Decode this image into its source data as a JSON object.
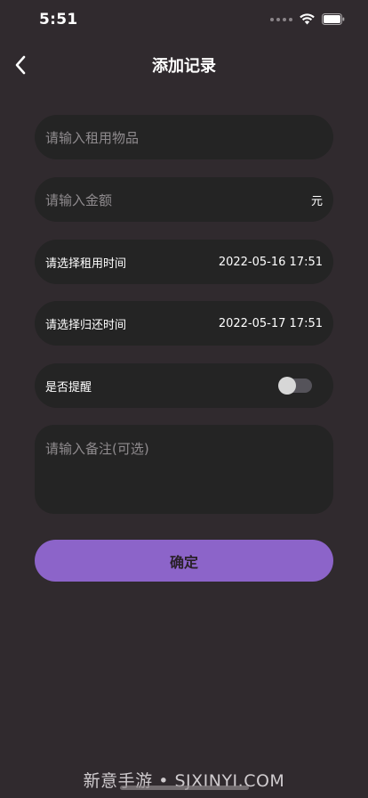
{
  "status_bar": {
    "time": "5:51"
  },
  "nav": {
    "title": "添加记录"
  },
  "form": {
    "item_placeholder": "请输入租用物品",
    "amount_placeholder": "请输入金额",
    "amount_unit": "元",
    "rent_time_label": "请选择租用时间",
    "rent_time_value": "2022-05-16 17:51",
    "return_time_label": "请选择归还时间",
    "return_time_value": "2022-05-17 17:51",
    "reminder_label": "是否提醒",
    "reminder_enabled": false,
    "notes_placeholder": "请输入备注(可选)"
  },
  "confirm_label": "确定",
  "watermark": "新意手游 • SJXINYI.COM",
  "colors": {
    "background": "#302a2e",
    "field": "#242424",
    "accent": "#8c64c9"
  }
}
